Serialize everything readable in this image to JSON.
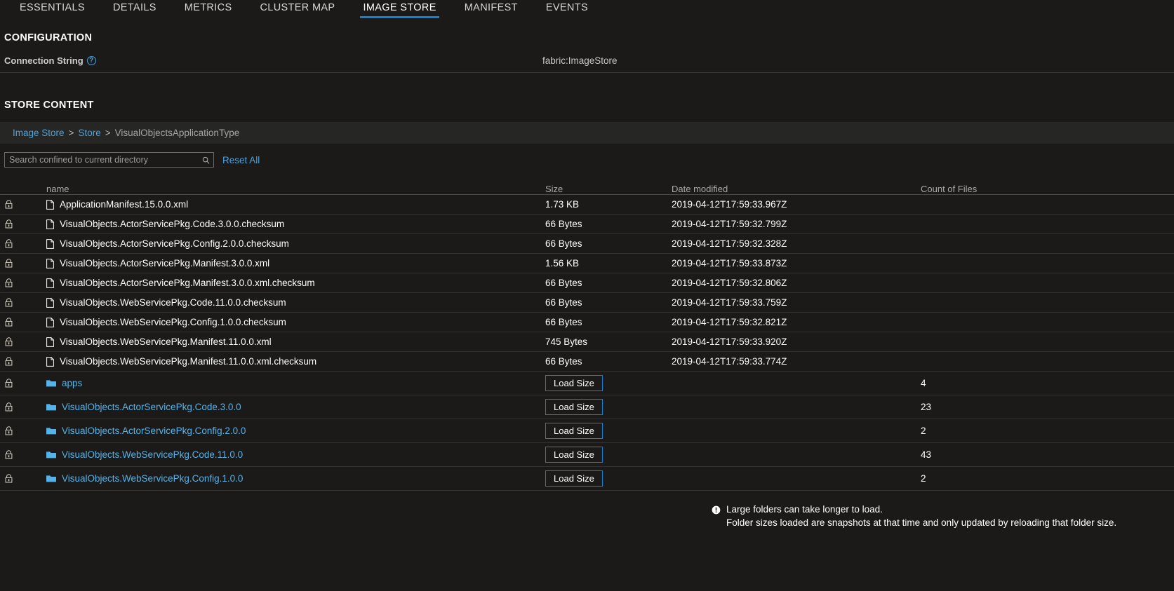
{
  "theme": {
    "accent": "#0a84d8",
    "link": "#4aa3df",
    "folder_link": "#56b3e8",
    "background": "#1b1a19"
  },
  "tabs": [
    {
      "label": "ESSENTIALS",
      "active": false
    },
    {
      "label": "DETAILS",
      "active": false
    },
    {
      "label": "METRICS",
      "active": false
    },
    {
      "label": "CLUSTER MAP",
      "active": false
    },
    {
      "label": "IMAGE STORE",
      "active": true
    },
    {
      "label": "MANIFEST",
      "active": false
    },
    {
      "label": "EVENTS",
      "active": false
    }
  ],
  "configuration": {
    "title": "CONFIGURATION",
    "connection_string_label": "Connection String",
    "connection_string_value": "fabric:ImageStore",
    "help_glyph": "?"
  },
  "store_content": {
    "title": "STORE CONTENT",
    "breadcrumb": [
      {
        "label": "Image Store",
        "link": true
      },
      {
        "label": "Store",
        "link": true
      },
      {
        "label": "VisualObjectsApplicationType",
        "link": false
      }
    ],
    "breadcrumb_separator": ">",
    "search": {
      "placeholder": "Search confined to current directory",
      "value": "",
      "reset_label": "Reset All"
    },
    "columns": {
      "name": "name",
      "size": "Size",
      "date_modified": "Date modified",
      "count_of_files": "Count of Files"
    },
    "load_size_label": "Load Size",
    "files": [
      {
        "name": "ApplicationManifest.15.0.0.xml",
        "size": "1.73 KB",
        "date": "2019-04-12T17:59:33.967Z"
      },
      {
        "name": "VisualObjects.ActorServicePkg.Code.3.0.0.checksum",
        "size": "66 Bytes",
        "date": "2019-04-12T17:59:32.799Z"
      },
      {
        "name": "VisualObjects.ActorServicePkg.Config.2.0.0.checksum",
        "size": "66 Bytes",
        "date": "2019-04-12T17:59:32.328Z"
      },
      {
        "name": "VisualObjects.ActorServicePkg.Manifest.3.0.0.xml",
        "size": "1.56 KB",
        "date": "2019-04-12T17:59:33.873Z"
      },
      {
        "name": "VisualObjects.ActorServicePkg.Manifest.3.0.0.xml.checksum",
        "size": "66 Bytes",
        "date": "2019-04-12T17:59:32.806Z"
      },
      {
        "name": "VisualObjects.WebServicePkg.Code.11.0.0.checksum",
        "size": "66 Bytes",
        "date": "2019-04-12T17:59:33.759Z"
      },
      {
        "name": "VisualObjects.WebServicePkg.Config.1.0.0.checksum",
        "size": "66 Bytes",
        "date": "2019-04-12T17:59:32.821Z"
      },
      {
        "name": "VisualObjects.WebServicePkg.Manifest.11.0.0.xml",
        "size": "745 Bytes",
        "date": "2019-04-12T17:59:33.920Z"
      },
      {
        "name": "VisualObjects.WebServicePkg.Manifest.11.0.0.xml.checksum",
        "size": "66 Bytes",
        "date": "2019-04-12T17:59:33.774Z"
      }
    ],
    "folders": [
      {
        "name": "apps",
        "count": "4"
      },
      {
        "name": "VisualObjects.ActorServicePkg.Code.3.0.0",
        "count": "23"
      },
      {
        "name": "VisualObjects.ActorServicePkg.Config.2.0.0",
        "count": "2"
      },
      {
        "name": "VisualObjects.WebServicePkg.Code.11.0.0",
        "count": "43"
      },
      {
        "name": "VisualObjects.WebServicePkg.Config.1.0.0",
        "count": "2"
      }
    ],
    "footer_note": {
      "line1": "Large folders can take longer to load.",
      "line2": "Folder sizes loaded are snapshots at that time and only updated by reloading that folder size."
    }
  }
}
